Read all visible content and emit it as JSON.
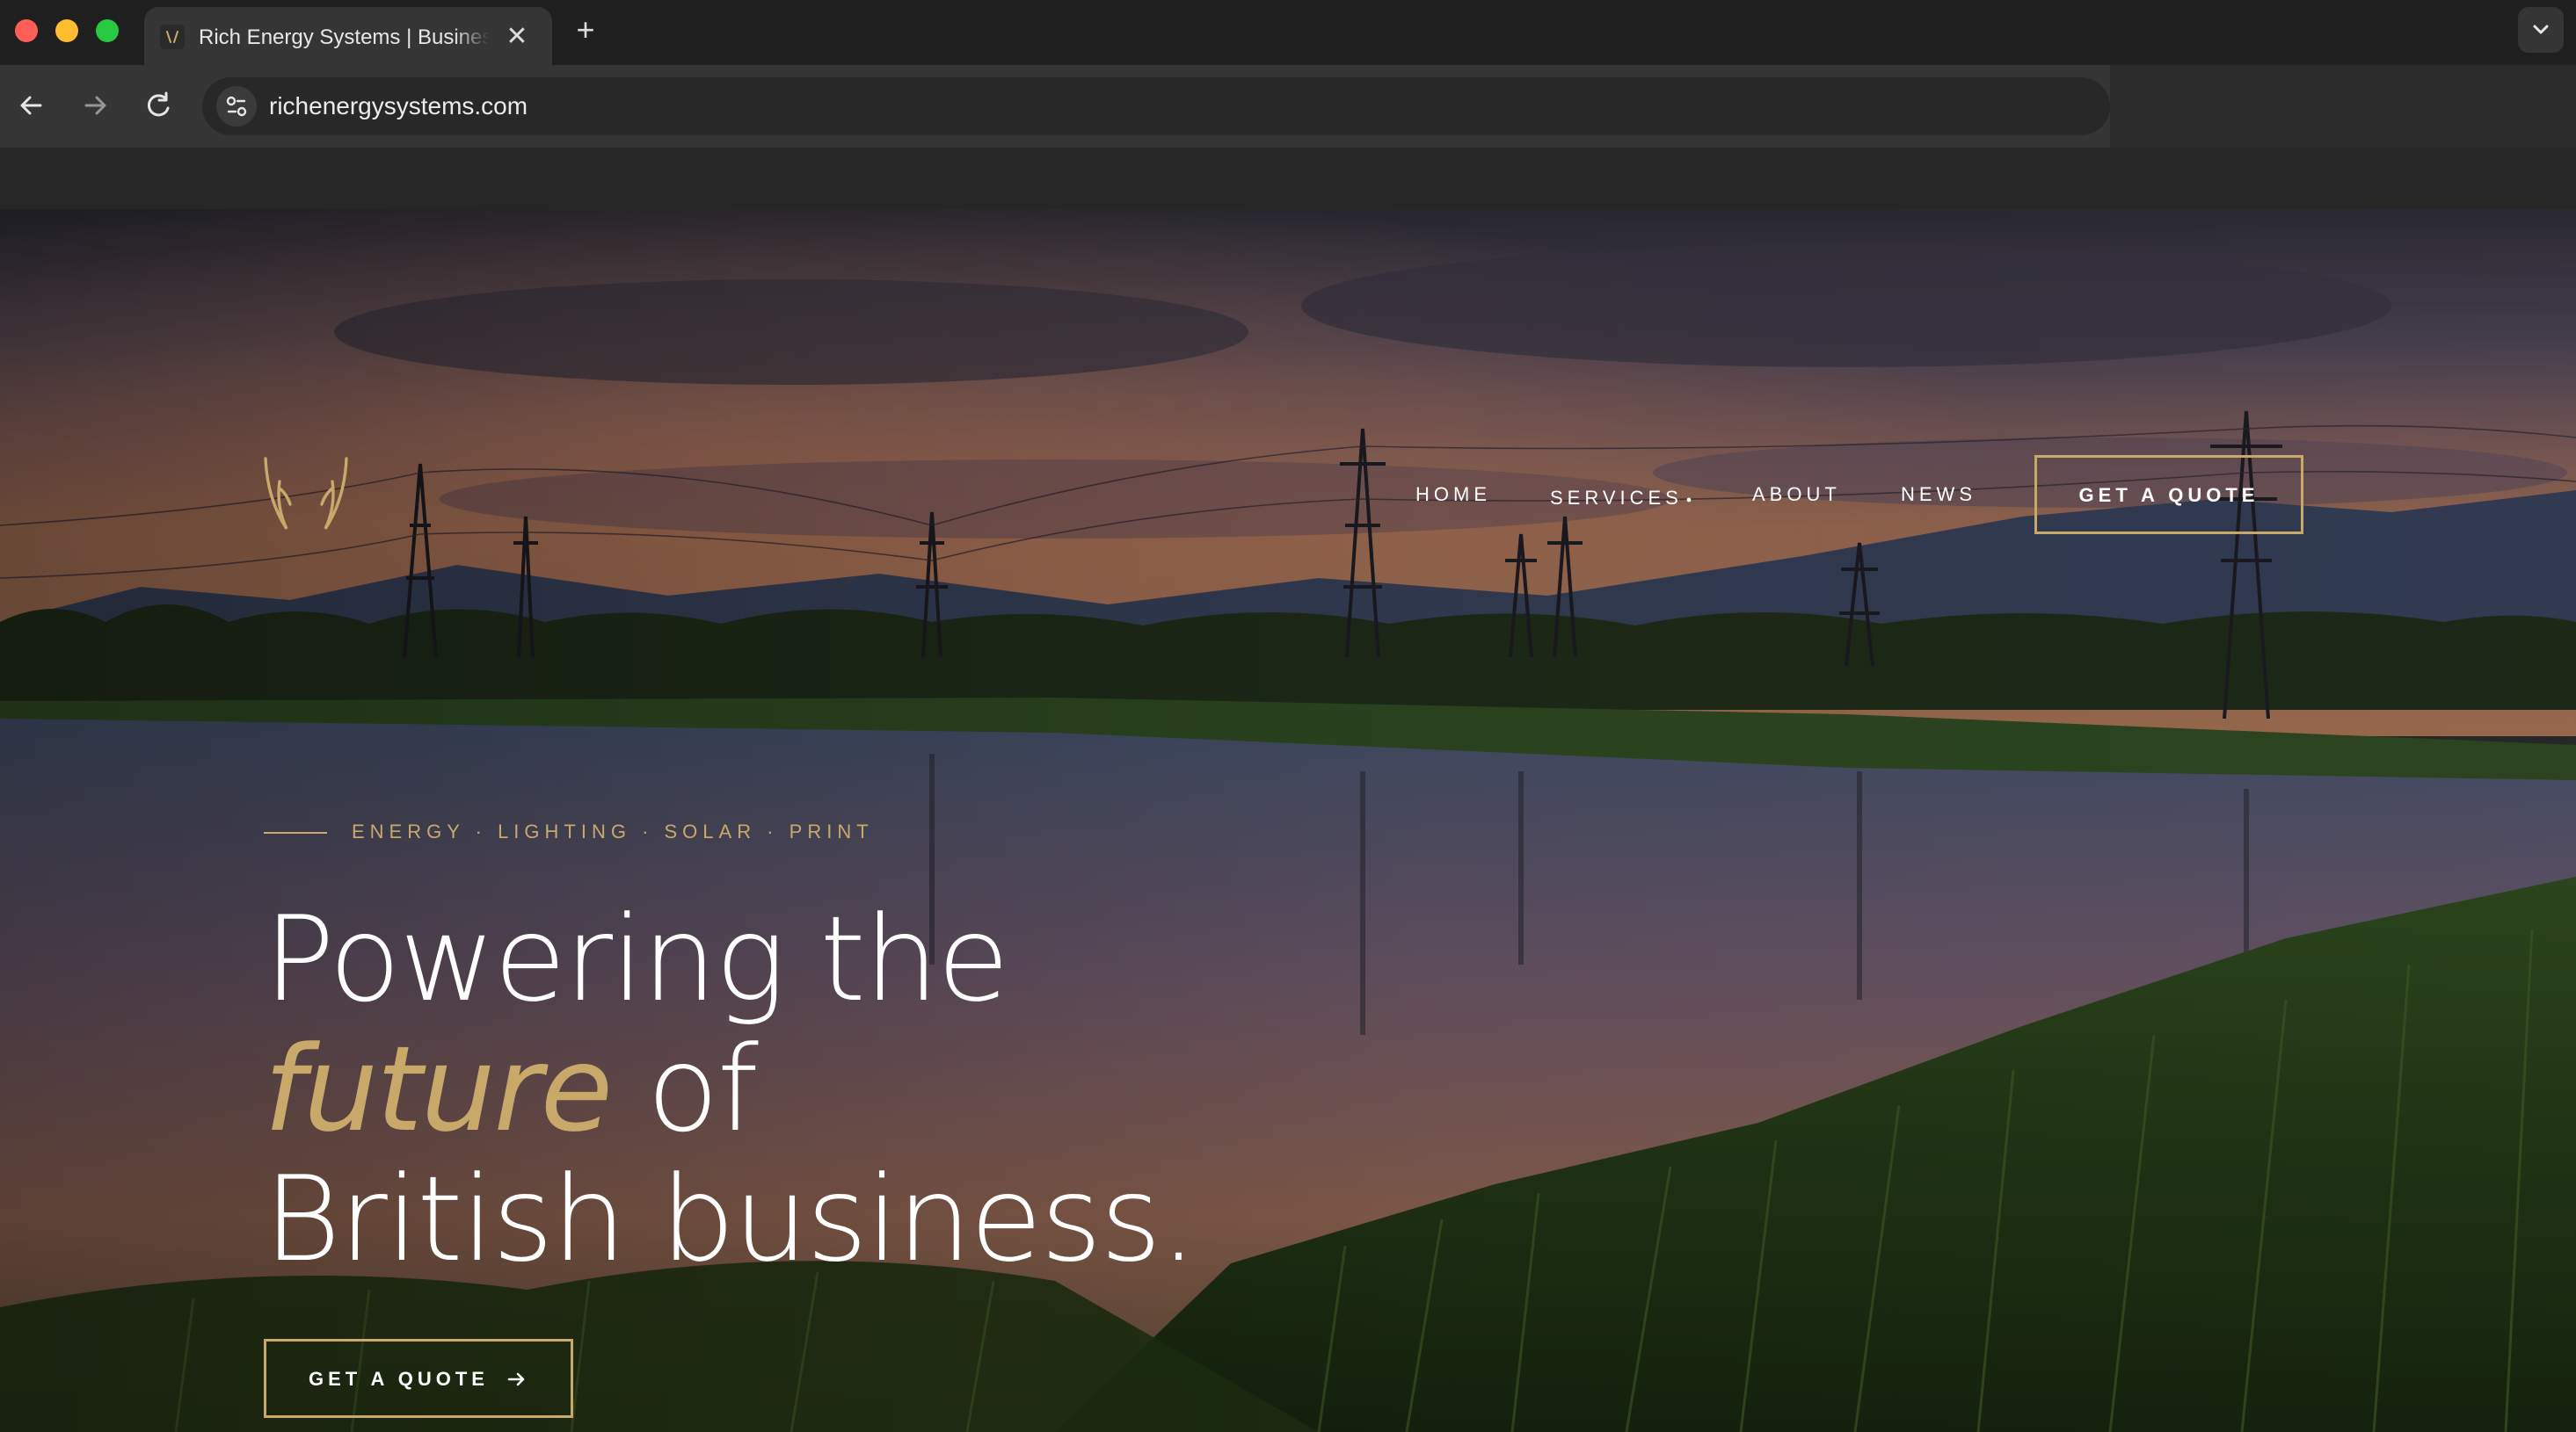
{
  "browser": {
    "tab": {
      "title": "Rich Energy Systems | Business Energy",
      "close_glyph": "✕"
    },
    "new_tab_glyph": "+",
    "url": "richenergysystems.com",
    "colors": {
      "close": "#ff5f57",
      "minimize": "#febc2e",
      "maximize": "#28c840"
    }
  },
  "site": {
    "nav": {
      "items": [
        {
          "label": "HOME"
        },
        {
          "label": "SERVICES"
        },
        {
          "label": "ABOUT"
        },
        {
          "label": "NEWS"
        }
      ],
      "cta_label": "GET A QUOTE"
    },
    "hero": {
      "kicker": "ENERGY · LIGHTING · SOLAR · PRINT",
      "headline": {
        "line1": "Powering the",
        "line2_accent": "future",
        "line2_rest": " of",
        "line3": "British business."
      },
      "cta_label": "GET A QUOTE"
    },
    "colors": {
      "accent": "#c8a96a"
    },
    "icons": {
      "logo": "antler-logo-icon",
      "caret": "chevron-down-icon",
      "arrow": "arrow-right-icon"
    }
  }
}
